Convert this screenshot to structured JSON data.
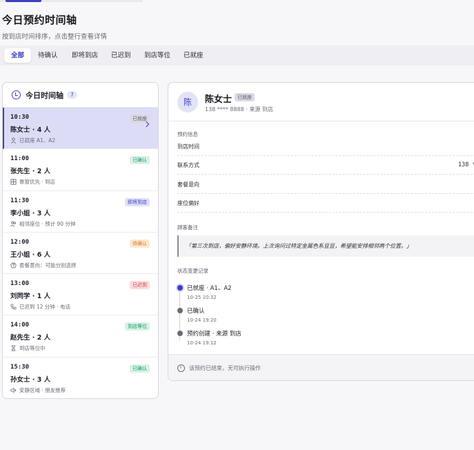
{
  "page": {
    "title": "今日预约时间轴",
    "subtitle": "按到店时间排序，点击整行查看详情"
  },
  "filters": [
    "全部",
    "待确认",
    "即将到店",
    "已迟到",
    "到店等位",
    "已就座"
  ],
  "active_filter": "全部",
  "timeline": {
    "title": "今日时间轴",
    "count": "7",
    "rows": [
      {
        "time": "10:30",
        "name": "陈女士 · 4 人",
        "note": "已就座 A1、A2",
        "badge": "已就座",
        "icon": "person-icon"
      },
      {
        "time": "11:00",
        "name": "张先生 · 2 人",
        "note": "靠窗优先 · 到店",
        "badge": "已确认",
        "icon": "grid-icon"
      },
      {
        "time": "11:30",
        "name": "李小姐 · 3 人",
        "note": "相邻座位 · 预计 90 分钟",
        "badge": "即将到店",
        "icon": "group-icon"
      },
      {
        "time": "12:00",
        "name": "王小姐 · 6 人",
        "note": "套餐意向：可能分别选择",
        "badge": "待确认",
        "icon": "question-icon"
      },
      {
        "time": "13:00",
        "name": "刘同学 · 1 人",
        "note": "已迟到 12 分钟 · 电话",
        "badge": "已迟到",
        "icon": "phone-icon"
      },
      {
        "time": "14:00",
        "name": "赵先生 · 2 人",
        "note": "到店等位中",
        "badge": "到店等位",
        "icon": "hourglass-icon"
      },
      {
        "time": "15:30",
        "name": "孙女士 · 3 人",
        "note": "安静区域 · 朋友推荐",
        "badge": "已确认",
        "icon": "mute-icon"
      }
    ]
  },
  "detail": {
    "avatar": "陈",
    "name": "陈女士",
    "status": "已就座",
    "meta": "138 **** 8888 · 来源 到店",
    "section_booking": "预约信息",
    "fields": [
      {
        "label": "到店时间",
        "value": ""
      },
      {
        "label": "联系方式",
        "value": "138 *"
      },
      {
        "label": "套餐意向",
        "value": ""
      },
      {
        "label": "座位偏好",
        "value": ""
      }
    ],
    "section_remark": "顾客备注",
    "remark": "「第三次到店，偏好安静环境。上次询问过特定金属色系豆豆，希望能安排相邻两个位置。」",
    "section_log": "状态变更记录",
    "logs": [
      {
        "title": "已就座 · A1、A2",
        "time": "10-25 10:32"
      },
      {
        "title": "已确认",
        "time": "10-24 19:20"
      },
      {
        "title": "预约创建 · 来源 到店",
        "time": "10-24 19:12"
      }
    ],
    "footer": "该预约已结束，无可执行操作"
  },
  "colors": {
    "accent": "#3b3fc2",
    "selected_row": "#dcdcf6",
    "confirmed": "#1b9a5c",
    "pending": "#d1791f",
    "late": "#d23c3c"
  }
}
